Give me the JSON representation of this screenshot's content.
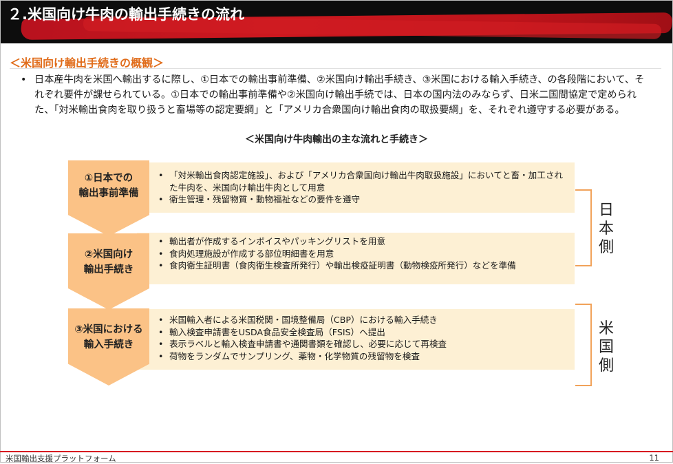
{
  "title": "２.米国向け牛肉の輸出手続きの流れ",
  "section_heading": "＜米国向け輸出手続きの概観＞",
  "intro": {
    "bullet": "•",
    "text": "日本産牛肉を米国へ輸出するに際し、①日本での輸出事前準備、②米国向け輸出手続き、③米国における輸入手続き、の各段階において、それぞれ要件が課せられている。①日本での輸出事前準備や②米国向け輸出手続では、日本の国内法のみならず、日米二国間協定で定められた、「対米輸出食肉を取り扱うと畜場等の認定要綱」と「アメリカ合衆国向け輸出食肉の取扱要綱」を、それぞれ遵守する必要がある。"
  },
  "flow_heading": "＜米国向け牛肉輸出の主な流れと手続き＞",
  "steps": [
    {
      "label_line1": "①日本での",
      "label_line2": "輸出事前準備",
      "items": [
        "「対米輸出食肉認定施設」、および「アメリカ合衆国向け輸出牛肉取扱施設」においてと畜・加工された牛肉を、米国向け輸出牛肉として用意",
        "衛生管理・残留物質・動物福祉などの要件を遵守"
      ]
    },
    {
      "label_line1": "②米国向け",
      "label_line2": "輸出手続き",
      "items": [
        "輸出者が作成するインボイスやパッキングリストを用意",
        "食肉処理施設が作成する部位明細書を用意",
        "食肉衛生証明書（食肉衛生検査所発行）や輸出検疫証明書（動物検疫所発行）などを準備"
      ]
    },
    {
      "label_line1": "③米国における",
      "label_line2": "輸入手続き",
      "items": [
        "米国輸入者による米国税関・国境整備局（CBP）における輸入手続き",
        "輸入検査申請書をUSDA食品安全検査局（FSIS）へ提出",
        "表示ラベルと輸入検査申請書や通関書類を確認し、必要に応じて再検査",
        "荷物をランダムでサンプリング、薬物・化学物質の残留物を検査"
      ]
    }
  ],
  "japan_side_label": [
    "日",
    "本",
    "側"
  ],
  "us_side_label": [
    "米",
    "国",
    "側"
  ],
  "footer": {
    "text": "米国輸出支援プラットフォーム",
    "page": "11"
  },
  "colors": {
    "title_bg": "#0d0d0d",
    "brush_red": "#d71920",
    "accent_orange": "#e06c1a",
    "chevron_fill": "#fbc286",
    "box_fill": "#fdf0d4",
    "bracket": "#f1a25a"
  }
}
